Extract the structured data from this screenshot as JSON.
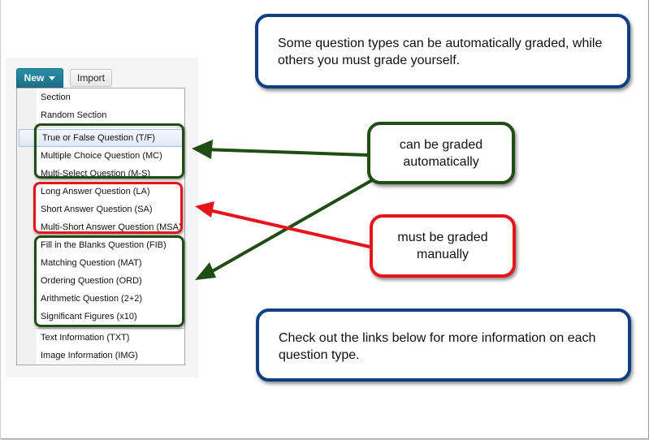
{
  "toolbar": {
    "new_label": "New",
    "import_label": "Import"
  },
  "menu": {
    "items": [
      {
        "label": "Section"
      },
      {
        "label": "Random Section"
      },
      {
        "label": "True or False Question (T/F)"
      },
      {
        "label": "Multiple Choice Question (MC)"
      },
      {
        "label": "Multi-Select Question (M-S)"
      },
      {
        "label": "Long Answer Question (LA)"
      },
      {
        "label": "Short Answer Question (SA)"
      },
      {
        "label": "Multi-Short Answer Question (MSA)"
      },
      {
        "label": "Fill in the Blanks Question (FIB)"
      },
      {
        "label": "Matching Question (MAT)"
      },
      {
        "label": "Ordering Question (ORD)"
      },
      {
        "label": "Arithmetic Question (2+2)"
      },
      {
        "label": "Significant Figures (x10)"
      },
      {
        "label": "Text Information (TXT)"
      },
      {
        "label": "Image Information (IMG)"
      }
    ]
  },
  "callouts": {
    "top": "Some question types can be automatically graded, while others you must grade yourself.",
    "auto": "can be graded automatically",
    "manual": "must be graded manually",
    "bottom": "Check out the links below for more information on each question type."
  },
  "colors": {
    "green": "#1f4d14",
    "red": "#e8141b",
    "blue": "#0f3f80",
    "button": "#1d6f87"
  }
}
